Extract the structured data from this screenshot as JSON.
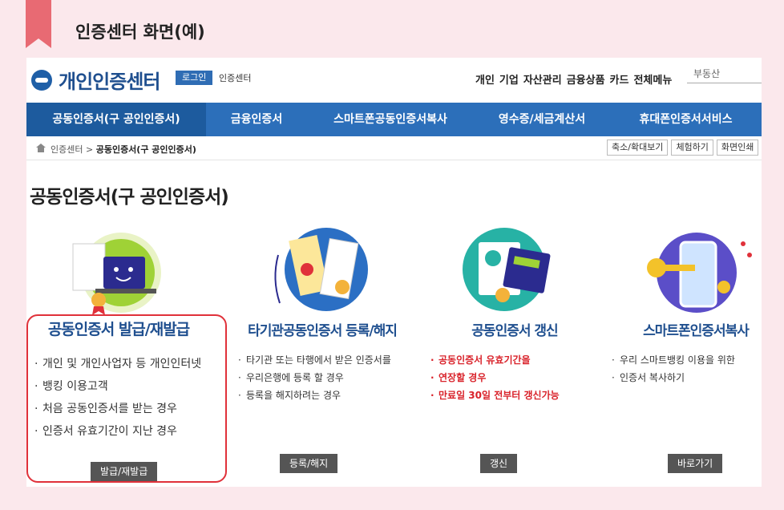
{
  "caption": "인증센터 화면(예)",
  "header": {
    "logo": "개인인증센터",
    "login": "로그인",
    "site_label": "인증센터",
    "top_menu": [
      "개인",
      "기업",
      "자산관리",
      "금융상품",
      "카드",
      "전체메뉴"
    ],
    "search_placeholder": "부동산"
  },
  "gnb": [
    "공동인증서(구 공인인증서)",
    "금융인증서",
    "스마트폰공동인증서복사",
    "영수증/세금계산서",
    "휴대폰인증서서비스"
  ],
  "breadcrumb": {
    "root": "인증센터",
    "sep": ">",
    "current": "공동인증서(구 공인인증서)"
  },
  "util_buttons": [
    "축소/확대보기",
    "체험하기",
    "화면인쇄"
  ],
  "page_title": "공동인증서(구 공인인증서)",
  "cards": [
    {
      "title": "공동인증서 발급/재발급",
      "items": [
        "개인 및 개인사업자 등 개인인터넷",
        "뱅킹 이용고객",
        "처음 공동인증서를 받는 경우",
        "인증서 유효기간이 지난 경우"
      ],
      "button": "발급/재발급"
    },
    {
      "title": "타기관공동인증서 등록/해지",
      "items": [
        "타기관 또는 타행에서 받은 인증서를",
        "우리은행에 등록 할 경우",
        "등록을 해지하려는 경우"
      ],
      "button": "등록/해지"
    },
    {
      "title": "공동인증서 갱신",
      "items": [
        "공동인증서 유효기간을",
        "연장할 경우",
        "만료일 30일 전부터 갱신가능"
      ],
      "button": "갱신"
    },
    {
      "title": "스마트폰인증서복사",
      "items": [
        "우리 스마트뱅킹 이용을 위한",
        "인증서 복사하기"
      ],
      "button": "바로가기"
    }
  ],
  "colors": {
    "brand_blue": "#2c6fba",
    "title_blue": "#1f4f8f",
    "highlight_red": "#e0313a",
    "background_pink": "#fbe8ec"
  }
}
